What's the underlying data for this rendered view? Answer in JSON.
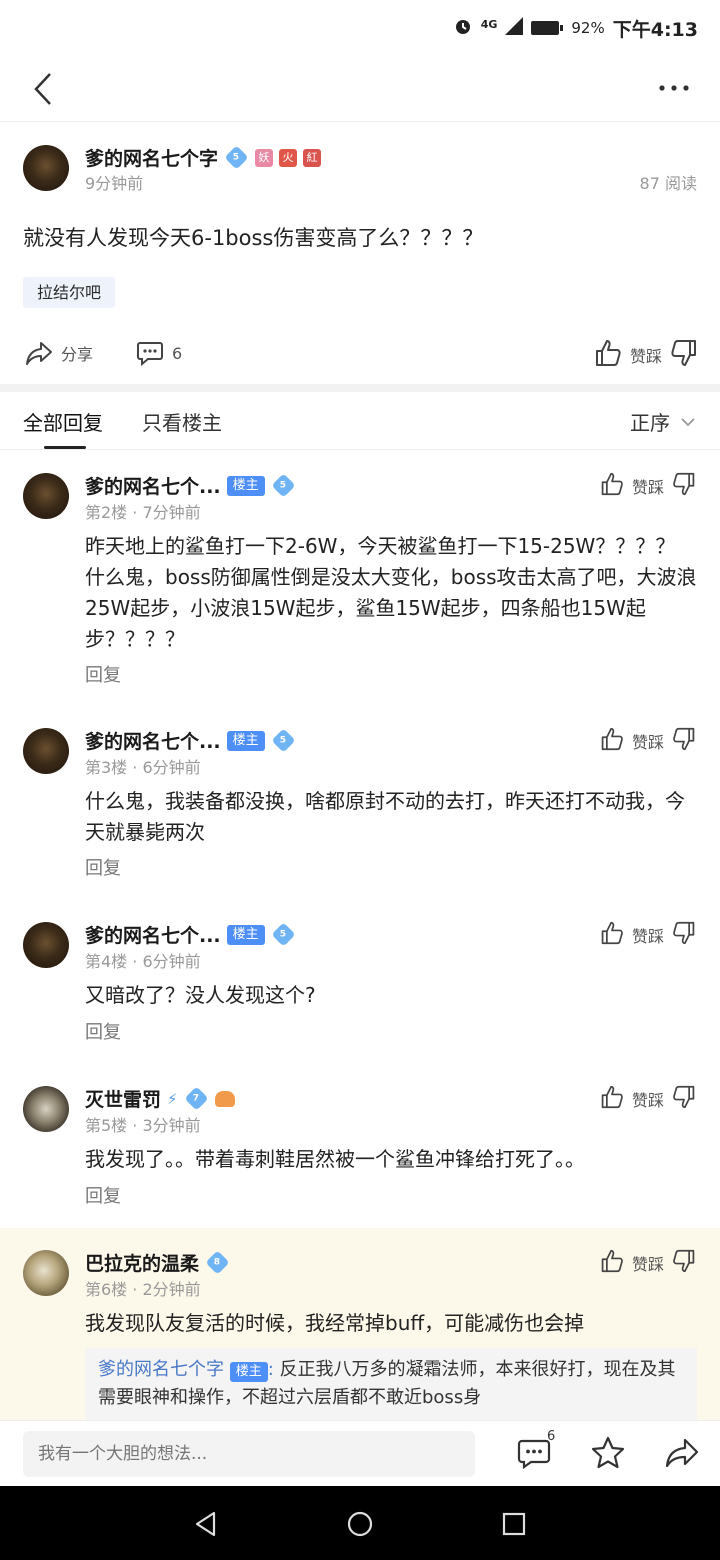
{
  "status_bar": {
    "network": "4G",
    "battery": "92%",
    "time": "下午4:13"
  },
  "post": {
    "author": "爹的网名七个字",
    "author_level": "5",
    "author_badges": [
      {
        "text": "妖",
        "color": "#e88aa6"
      },
      {
        "text": "火",
        "color": "#e0574a"
      },
      {
        "text": "紅",
        "color": "#d9534f"
      }
    ],
    "time": "9分钟前",
    "reads": "87 阅读",
    "title": "就没有人发现今天6-1boss伤害变高了么？？？？",
    "forum_tag": "拉结尔吧",
    "share_label": "分享",
    "comment_count": "6",
    "vote_label": "赞踩"
  },
  "tabs": {
    "all_replies": "全部回复",
    "only_op": "只看楼主",
    "sort": "正序"
  },
  "replies": [
    {
      "name": "爹的网名七个...",
      "op_badge": "楼主",
      "level": "5",
      "meta": "第2楼 · 7分钟前",
      "body": "昨天地上的鲨鱼打一下2-6W，今天被鲨鱼打一下15-25W？？？？ 什么鬼，boss防御属性倒是没太大变化，boss攻击太高了吧，大波浪25W起步，小波浪15W起步，鲨鱼15W起步，四条船也15W起步？？？？",
      "reply_label": "回复",
      "vote_label": "赞踩"
    },
    {
      "name": "爹的网名七个...",
      "op_badge": "楼主",
      "level": "5",
      "meta": "第3楼 · 6分钟前",
      "body": "什么鬼，我装备都没换，啥都原封不动的去打，昨天还打不动我，今天就暴毙两次",
      "reply_label": "回复",
      "vote_label": "赞踩"
    },
    {
      "name": "爹的网名七个...",
      "op_badge": "楼主",
      "level": "5",
      "meta": "第4楼 · 6分钟前",
      "body": "又暗改了？没人发现这个?",
      "reply_label": "回复",
      "vote_label": "赞踩"
    },
    {
      "name": "灭世雷罚",
      "level": "7",
      "meta": "第5楼 · 3分钟前",
      "body": "我发现了。。带着毒刺鞋居然被一个鲨鱼冲锋给打死了。。",
      "reply_label": "回复",
      "vote_label": "赞踩"
    },
    {
      "name": "巴拉克的温柔",
      "level": "8",
      "meta": "第6楼 · 2分钟前",
      "body": "我发现队友复活的时候，我经常掉buff，可能减伤也会掉",
      "vote_label": "赞踩",
      "sub_reply": {
        "name": "爹的网名七个字",
        "op_badge": "楼主",
        "colon": ":",
        "text": "反正我八万多的凝霜法师，本来很好打，现在及其需要眼神和操作，不超过六层盾都不敢近boss身"
      }
    }
  ],
  "bottom_bar": {
    "placeholder": "我有一个大胆的想法...",
    "comment_count": "6"
  }
}
